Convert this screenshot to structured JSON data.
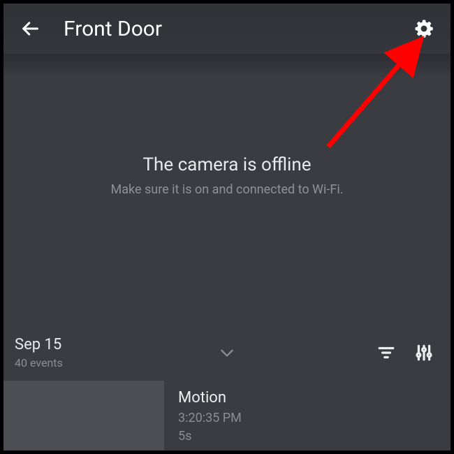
{
  "header": {
    "title": "Front Door"
  },
  "offline": {
    "title": "The camera is offline",
    "subtitle": "Make sure it is on and connected to Wi-Fi."
  },
  "events_bar": {
    "date": "Sep 15",
    "count": "40 events"
  },
  "event": {
    "title": "Motion",
    "time": "3:20:35 PM",
    "duration": "5s"
  }
}
